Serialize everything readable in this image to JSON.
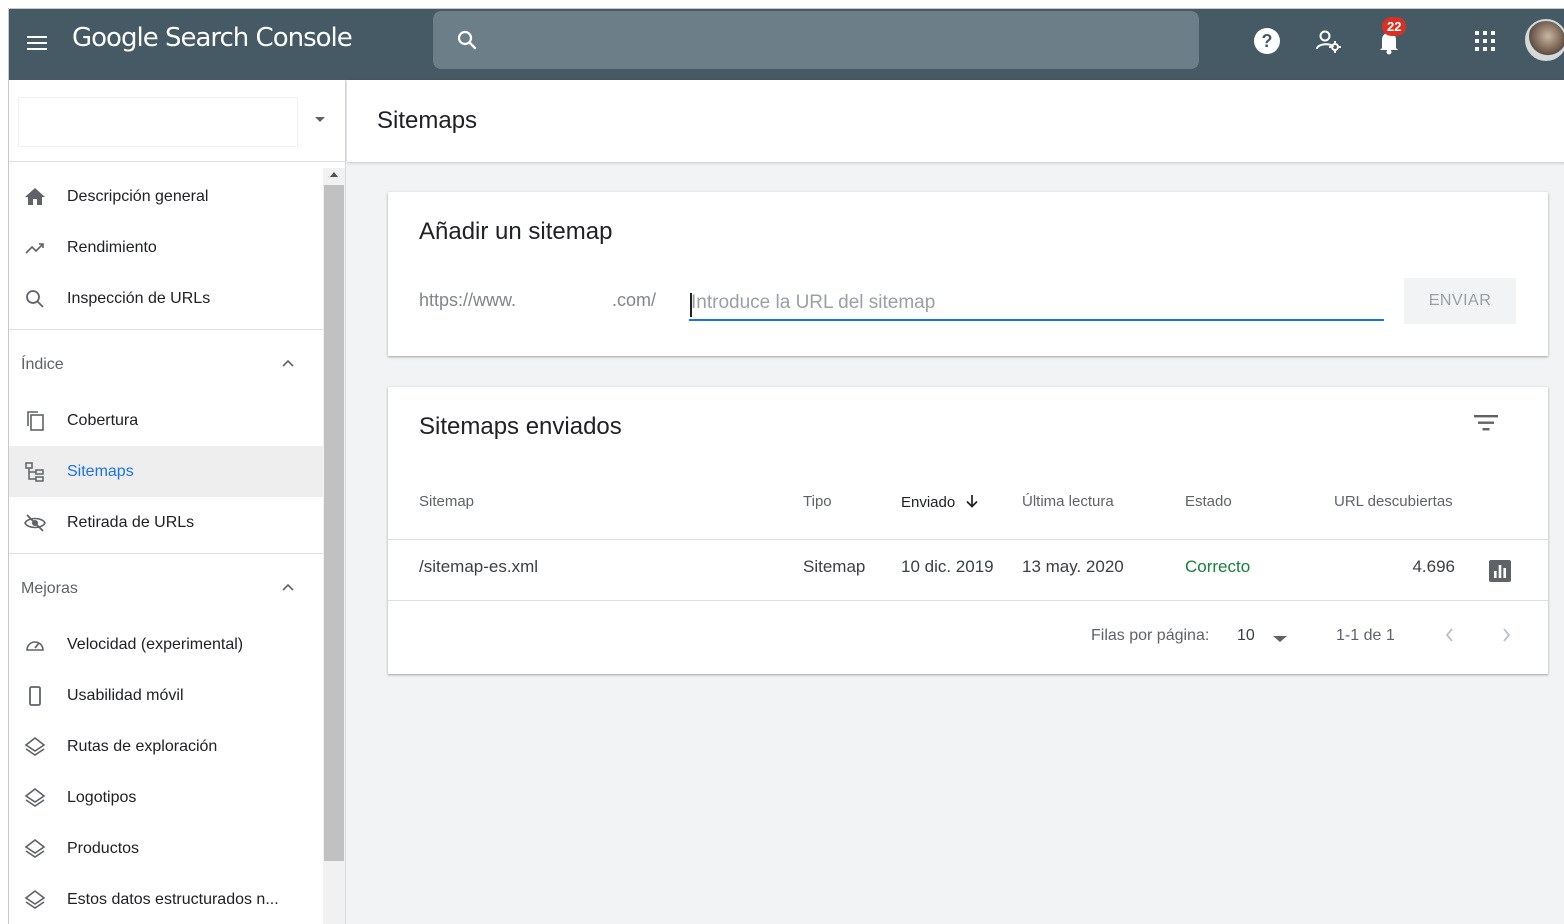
{
  "app": {
    "title": "Google Search Console",
    "notification_count": "22"
  },
  "sidebar": {
    "items_top": [
      {
        "label": "Descripción general",
        "icon": "home-icon"
      },
      {
        "label": "Rendimiento",
        "icon": "trending-up-icon"
      },
      {
        "label": "Inspección de URLs",
        "icon": "search-icon"
      }
    ],
    "section_index": "Índice",
    "items_index": [
      {
        "label": "Cobertura",
        "icon": "coverage-icon"
      },
      {
        "label": "Sitemaps",
        "icon": "sitemap-icon",
        "active": true
      },
      {
        "label": "Retirada de URLs",
        "icon": "visibility-off-icon"
      }
    ],
    "section_enhancements": "Mejoras",
    "items_enhancements": [
      {
        "label": "Velocidad (experimental)",
        "icon": "speed-icon"
      },
      {
        "label": "Usabilidad móvil",
        "icon": "phone-icon"
      },
      {
        "label": "Rutas de exploración",
        "icon": "layers-icon"
      },
      {
        "label": "Logotipos",
        "icon": "layers-icon"
      },
      {
        "label": "Productos",
        "icon": "layers-icon"
      },
      {
        "label": "Estos datos estructurados n...",
        "icon": "layers-icon"
      }
    ]
  },
  "main": {
    "page_title": "Sitemaps",
    "add_sitemap": {
      "title": "Añadir un sitemap",
      "url_prefix_start": "https://www.",
      "url_prefix_end": ".com/",
      "input_value": "",
      "input_placeholder": "Introduce la URL del sitemap",
      "submit_label": "ENVIAR"
    },
    "submitted": {
      "title": "Sitemaps enviados",
      "columns": {
        "sitemap": "Sitemap",
        "type": "Tipo",
        "submitted": "Enviado",
        "last_read": "Última lectura",
        "status": "Estado",
        "discovered": "URL descubiertas"
      },
      "rows": [
        {
          "sitemap": "/sitemap-es.xml",
          "type": "Sitemap",
          "submitted": "10 dic. 2019",
          "last_read": "13 may. 2020",
          "status": "Correcto",
          "discovered": "4.696"
        }
      ],
      "pagination": {
        "rows_per_page_label": "Filas por página:",
        "rows_per_page": "10",
        "range": "1-1 de 1"
      }
    }
  },
  "colors": {
    "topbar": "#455a64",
    "accent": "#1a73e8",
    "status_ok": "#188038"
  }
}
